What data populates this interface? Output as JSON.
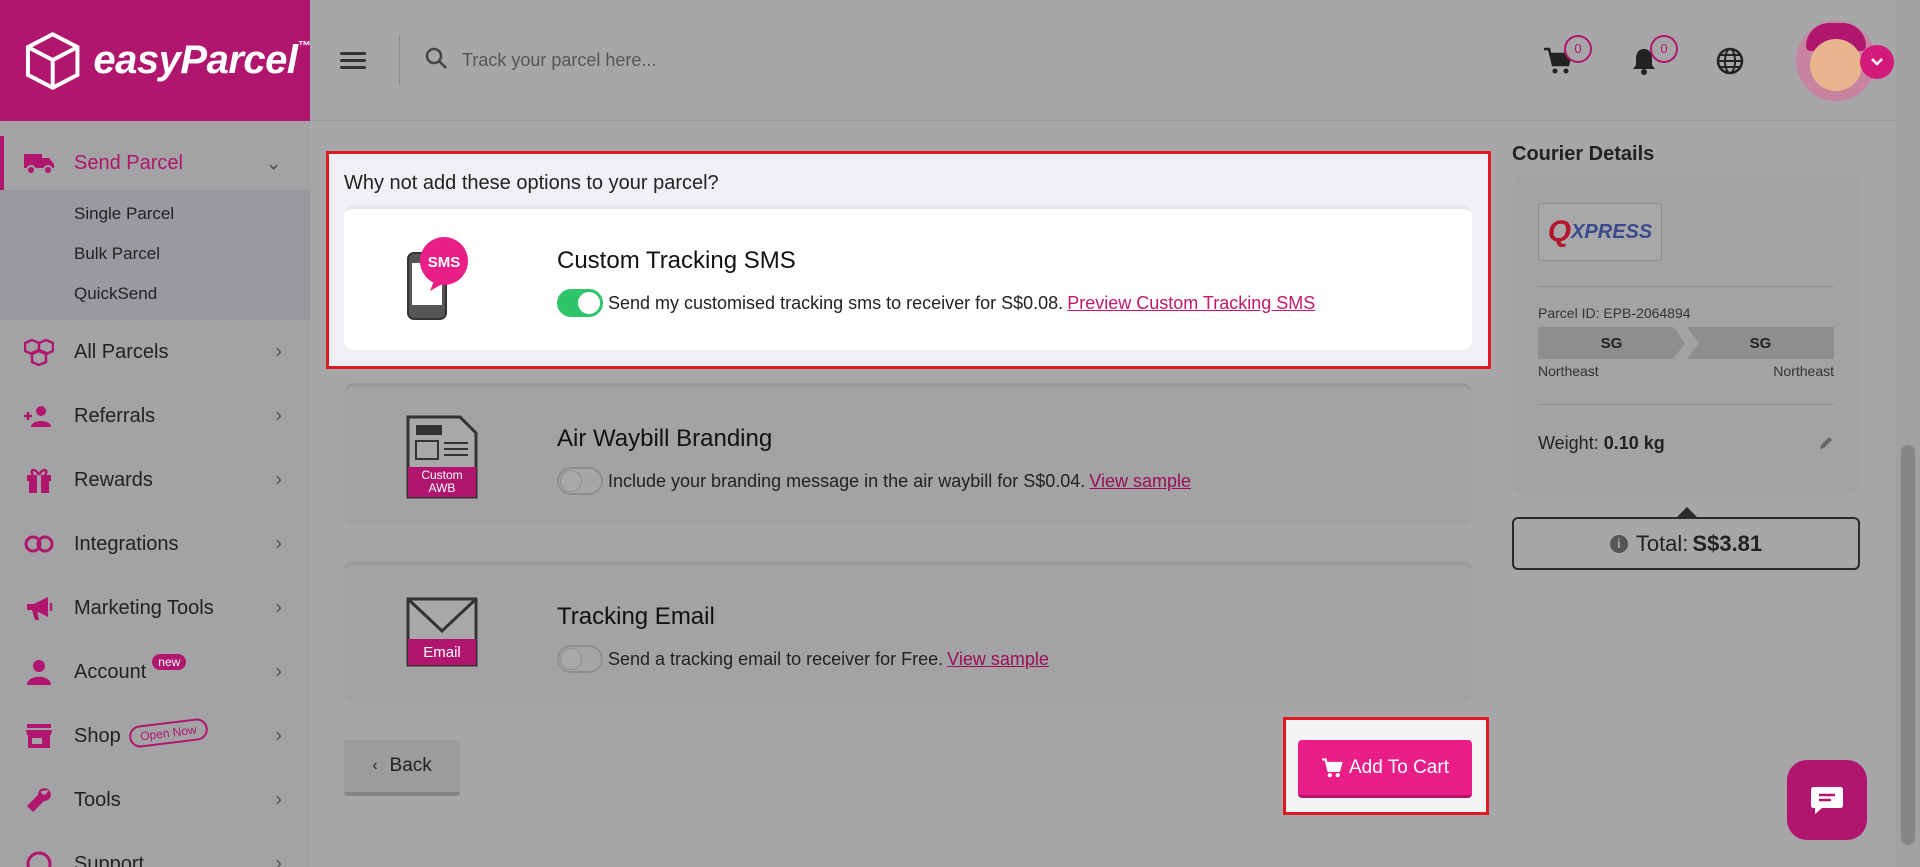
{
  "brand": {
    "logo_text": "easyParcel",
    "tm": "™",
    "primary_color": "#b0166e",
    "accent_color": "#e91e87"
  },
  "search": {
    "placeholder": "Track your parcel here..."
  },
  "header": {
    "cart_count": "0",
    "notification_count": "0"
  },
  "sidebar": {
    "active": {
      "label": "Send Parcel",
      "icon": "truck-icon"
    },
    "subitems": [
      "Single Parcel",
      "Bulk Parcel",
      "QuickSend"
    ],
    "items": [
      {
        "label": "All Parcels",
        "icon": "boxes-icon"
      },
      {
        "label": "Referrals",
        "icon": "users-add-icon"
      },
      {
        "label": "Rewards",
        "icon": "gift-icon"
      },
      {
        "label": "Integrations",
        "icon": "link-icon"
      },
      {
        "label": "Marketing Tools",
        "icon": "megaphone-icon"
      },
      {
        "label": "Account",
        "icon": "person-icon",
        "badge": "new"
      },
      {
        "label": "Shop",
        "icon": "store-icon",
        "badge": "Open Now"
      },
      {
        "label": "Tools",
        "icon": "wrench-icon"
      },
      {
        "label": "Support",
        "icon": "support-icon"
      }
    ]
  },
  "options": {
    "heading": "Why not add these options to your parcel?",
    "items": [
      {
        "title": "Custom Tracking SMS",
        "description": "Send my customised tracking sms to receiver for S$0.08.",
        "link": "Preview Custom Tracking SMS",
        "enabled": true,
        "icon_label": "SMS"
      },
      {
        "title": "Air Waybill Branding",
        "description": "Include your branding message in the air waybill for S$0.04.",
        "link": "View sample",
        "enabled": false,
        "icon_label": "Custom AWB",
        "icon_label_line1": "Custom",
        "icon_label_line2": "AWB"
      },
      {
        "title": "Tracking Email",
        "description": "Send a tracking email to receiver for Free.",
        "link": "View sample",
        "enabled": false,
        "icon_label": "Email"
      }
    ]
  },
  "actions": {
    "back": "Back",
    "add_to_cart": "Add To Cart"
  },
  "courier": {
    "title": "Courier Details",
    "logo_q": "Q",
    "logo_rest": "XPRESS",
    "parcel_id": "Parcel ID: EPB-2064894",
    "from_code": "SG",
    "to_code": "SG",
    "from_region": "Northeast",
    "to_region": "Northeast",
    "weight_label": "Weight:",
    "weight_value": "0.10 kg"
  },
  "total": {
    "label": "Total:",
    "value": "S$3.81"
  }
}
